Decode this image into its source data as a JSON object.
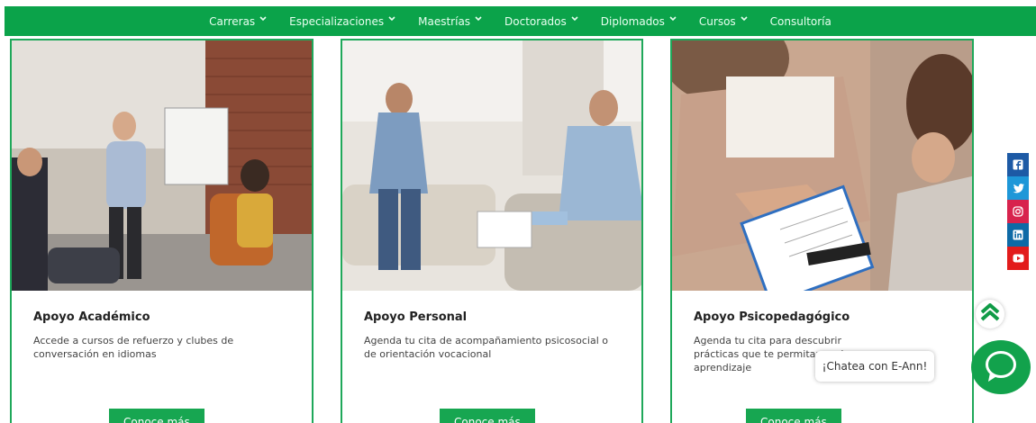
{
  "nav": {
    "items": [
      {
        "label": "Carreras",
        "dropdown": true
      },
      {
        "label": "Especializaciones",
        "dropdown": true
      },
      {
        "label": "Maestrías",
        "dropdown": true
      },
      {
        "label": "Doctorados",
        "dropdown": true
      },
      {
        "label": "Diplomados",
        "dropdown": true
      },
      {
        "label": "Cursos",
        "dropdown": true
      },
      {
        "label": "Consultoría",
        "dropdown": false
      }
    ]
  },
  "cards": [
    {
      "title": "Apoyo Académico",
      "description": "Accede a cursos de refuerzo y clubes de conversación en idiomas",
      "button": "Conoce más"
    },
    {
      "title": "Apoyo Personal",
      "description": "Agenda tu cita de acompañamiento psicosocial o de orientación vocacional",
      "button": "Conoce más"
    },
    {
      "title": "Apoyo Psicopedagógico",
      "description": "Agenda tu cita para descubrir prácticas que te permitan mej aprendizaje",
      "button": "Conoce más"
    }
  ],
  "social": [
    {
      "icon": "facebook-icon",
      "color": "#1d5aa5"
    },
    {
      "icon": "twitter-icon",
      "color": "#1e97d8"
    },
    {
      "icon": "instagram-icon",
      "color": "#d8234d"
    },
    {
      "icon": "linkedin-icon",
      "color": "#0e6aa6"
    },
    {
      "icon": "youtube-icon",
      "color": "#e21c1c"
    }
  ],
  "chat": {
    "label": "¡Chatea con E-Ann!"
  },
  "colors": {
    "brand_green": "#0ba34a",
    "card_border": "#1fa85a"
  }
}
